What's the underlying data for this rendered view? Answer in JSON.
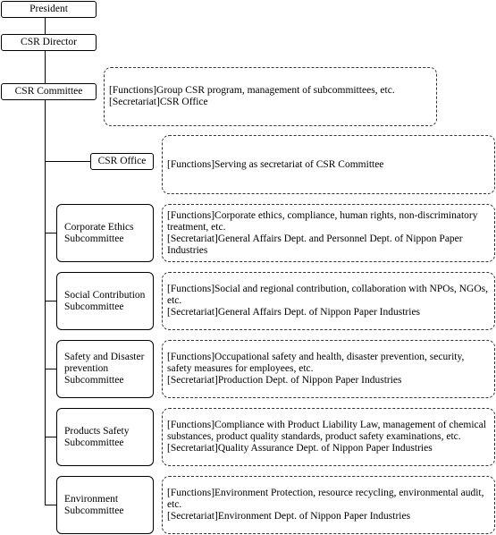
{
  "president": "President",
  "director": "CSR Director",
  "committee": {
    "name": "CSR Committee",
    "functions": "[Functions]Group CSR program, management of subcommittees, etc.",
    "secretariat": "[Secretariat]CSR Office"
  },
  "office": {
    "name": "CSR Office",
    "functions": "[Functions]Serving as secretariat of CSR Committee"
  },
  "subcommittees": [
    {
      "name": "Corporate Ethics Subcommittee",
      "functions": "[Functions]Corporate ethics, compliance, human rights, non-discriminatory treatment, etc.",
      "secretariat": "[Secretariat]General Affairs Dept. and Personnel Dept. of Nippon Paper Industries"
    },
    {
      "name": "Social Contribution Subcommittee",
      "functions": "[Functions]Social and regional contribution, collaboration with NPOs, NGOs, etc.",
      "secretariat": "[Secretariat]General Affairs Dept. of Nippon Paper Industries"
    },
    {
      "name": "Safety and Disaster prevention Subcommittee",
      "functions": "[Functions]Occupational safety and health, disaster prevention, security, safety measures for employees, etc.",
      "secretariat": "[Secretariat]Production Dept. of Nippon Paper Industries"
    },
    {
      "name": "Products Safety Subcommittee",
      "functions": "[Functions]Compliance with Product Liability Law, management of chemical substances, product quality standards, product safety examinations, etc.",
      "secretariat": "[Secretariat]Quality Assurance Dept. of Nippon Paper Industries"
    },
    {
      "name": "Environment Subcommittee",
      "functions": "[Functions]Environment Protection, resource recycling, environmental audit, etc.",
      "secretariat": "[Secretariat]Environment Dept. of Nippon Paper Industries"
    }
  ]
}
